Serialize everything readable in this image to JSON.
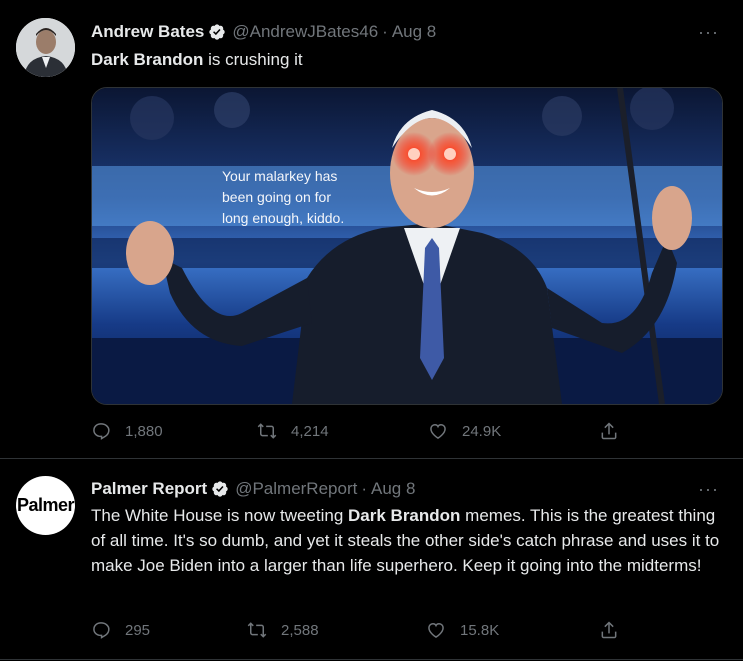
{
  "tweets": [
    {
      "author_name": "Andrew Bates",
      "handle": "@AndrewJBates46",
      "separator": "·",
      "date": "Aug 8",
      "more": "···",
      "text_bold": "Dark Brandon",
      "text_rest": " is crushing it",
      "media": {
        "caption_lines": [
          "Your malarkey has",
          "been going on for",
          "long enough, kiddo."
        ]
      },
      "stats": {
        "replies": "1,880",
        "retweets": "4,214",
        "likes": "24.9K"
      }
    },
    {
      "author_name": "Palmer Report",
      "handle": "@PalmerReport",
      "separator": "·",
      "date": "Aug 8",
      "more": "···",
      "avatar_logo": "Palmer",
      "text_before": "The White House is now tweeting ",
      "text_bold": "Dark Brandon",
      "text_after": " memes. This is the greatest thing of all time. It's so dumb, and yet it steals the other side's catch phrase and uses it to make Joe Biden into a larger than life superhero. Keep it going into the midterms!",
      "stats": {
        "replies": "295",
        "retweets": "2,588",
        "likes": "15.8K"
      }
    }
  ],
  "colors": {
    "background": "#000000",
    "text": "#e7e9ea",
    "muted": "#71767b",
    "divider": "#2f3336"
  },
  "icons": [
    "verified-badge-icon",
    "reply-icon",
    "retweet-icon",
    "like-icon",
    "share-icon",
    "more-icon"
  ]
}
